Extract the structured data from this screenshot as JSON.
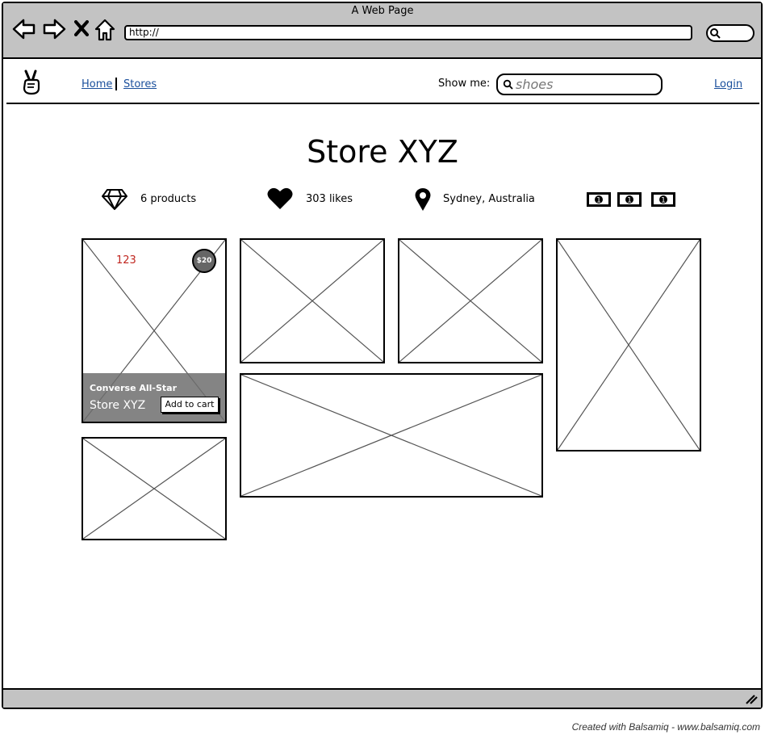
{
  "window": {
    "title": "A Web Page",
    "url": "http://"
  },
  "header": {
    "nav": [
      {
        "label": "Home"
      },
      {
        "label": "Stores"
      }
    ],
    "show_me_label": "Show me:",
    "search_placeholder": "shoes",
    "login_label": "Login"
  },
  "store": {
    "name": "Store XYZ",
    "stats": [
      {
        "icon": "diamond-icon",
        "text": "6 products"
      },
      {
        "icon": "heart-icon",
        "text": "303 likes"
      },
      {
        "icon": "map-pin-icon",
        "text": "Sydney, Australia"
      }
    ],
    "price_level_icons": [
      "money-icon",
      "money-icon",
      "money-icon"
    ]
  },
  "featured_product": {
    "name": "Converse All-Star",
    "store": "Store XYZ",
    "likes": "123",
    "price": "$20",
    "add_to_cart_label": "Add to cart"
  },
  "footer": {
    "credit": "Created with Balsamiq - www.balsamiq.com"
  },
  "colors": {
    "chrome": "#c3c3c3",
    "link": "#1a4f9c",
    "like": "#c0261f",
    "overlay": "#6e6e6e"
  }
}
